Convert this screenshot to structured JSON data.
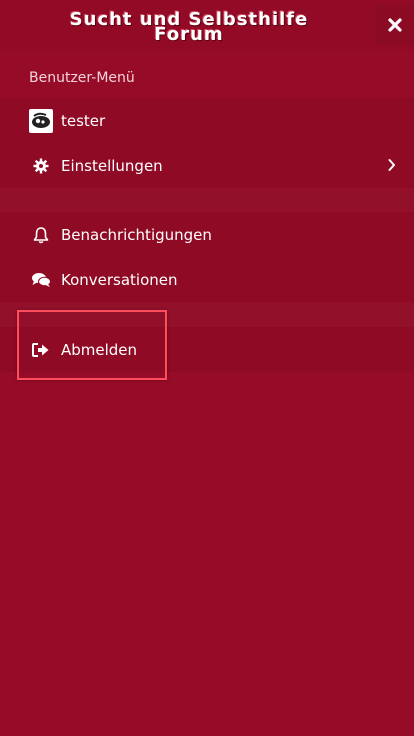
{
  "header": {
    "logo_line1": "Sucht und Selbsthilfe",
    "logo_line2": "Forum",
    "close_icon": "close-icon"
  },
  "menu": {
    "title": "Benutzer-Menü",
    "items": [
      {
        "label": "tester",
        "icon": "avatar"
      },
      {
        "label": "Einstellungen",
        "icon": "gear-icon"
      },
      {
        "label": "Benachrichtigungen",
        "icon": "bell-icon"
      },
      {
        "label": "Konversationen",
        "icon": "chat-bubbles-icon"
      },
      {
        "label": "Abmelden",
        "icon": "logout-icon"
      }
    ]
  },
  "colors": {
    "background": "#960b28",
    "row": "#8f0a25",
    "highlight": "#ff4d5e"
  }
}
